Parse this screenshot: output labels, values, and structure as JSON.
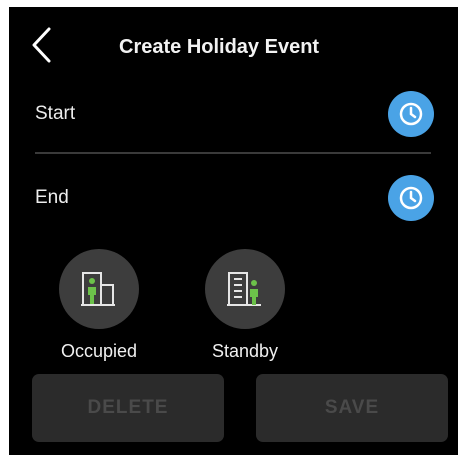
{
  "header": {
    "title": "Create Holiday Event",
    "back_icon": "chevron-left-icon"
  },
  "fields": {
    "start_label": "Start",
    "end_label": "End",
    "picker_icon": "clock-icon"
  },
  "modes": {
    "occupied_label": "Occupied",
    "occupied_icon": "occupied-building-icon",
    "standby_label": "Standby",
    "standby_icon": "standby-building-icon"
  },
  "actions": {
    "delete_label": "DELETE",
    "save_label": "SAVE"
  },
  "colors": {
    "background": "#000000",
    "accent": "#4aa3e6",
    "icon_green": "#6cc24a",
    "mode_circle": "#3d3d3d",
    "disabled_button": "#2b2b2b",
    "disabled_text": "#4a4a4a"
  }
}
